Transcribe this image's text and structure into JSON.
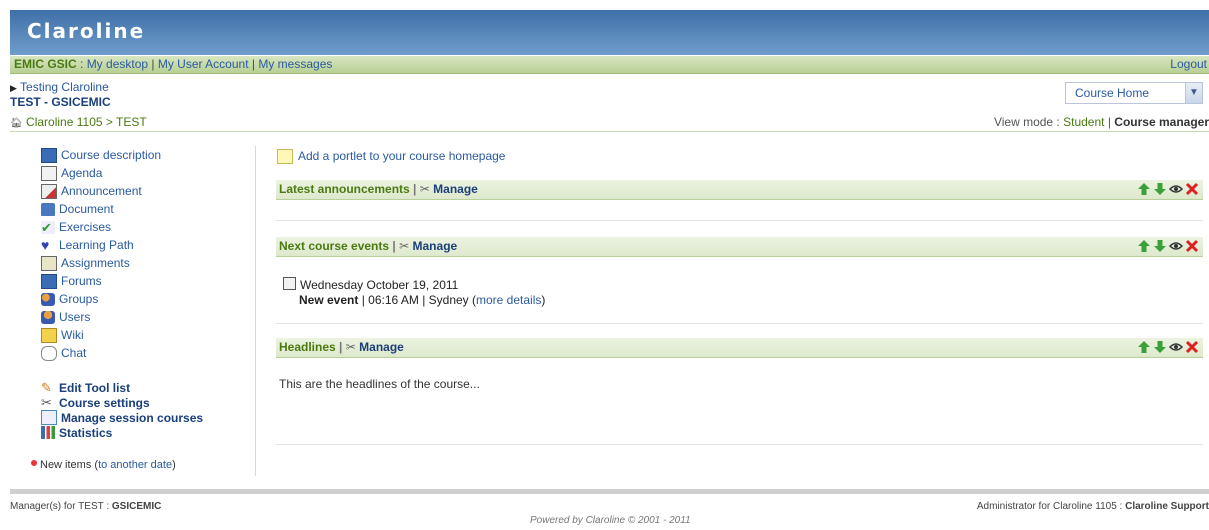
{
  "banner": {
    "title": "Claroline"
  },
  "userbar": {
    "user": "EMIC GSIC",
    "links": [
      "My desktop",
      "My User Account",
      "My messages"
    ],
    "logout": "Logout"
  },
  "course": {
    "category": "Testing Claroline",
    "name": "TEST - GSICEMIC",
    "tool_select": "Course Home"
  },
  "breadcrumb": {
    "platform": "Claroline 1105",
    "sep": ">",
    "course": "TEST"
  },
  "viewmode": {
    "label": "View mode :",
    "student": "Student",
    "divider": "|",
    "current": "Course manager"
  },
  "tools": [
    {
      "label": "Course description",
      "icon": "course-description-icon",
      "color": "#3a6db5"
    },
    {
      "label": "Agenda",
      "icon": "agenda-icon",
      "color": "#6d6d6d"
    },
    {
      "label": "Announcement",
      "icon": "announcement-icon",
      "color": "#b5463a"
    },
    {
      "label": "Document",
      "icon": "folder-icon",
      "color": "#3a6db5"
    },
    {
      "label": "Exercises",
      "icon": "checkmark-icon",
      "color": "#3a9a3a"
    },
    {
      "label": "Learning Path",
      "icon": "heart-icon",
      "color": "#3a4ab5"
    },
    {
      "label": "Assignments",
      "icon": "assignment-icon",
      "color": "#7a7a3a"
    },
    {
      "label": "Forums",
      "icon": "forum-icon",
      "color": "#3a6db5"
    },
    {
      "label": "Groups",
      "icon": "groups-icon",
      "color": "#c07a2a"
    },
    {
      "label": "Users",
      "icon": "user-icon",
      "color": "#c07a2a"
    },
    {
      "label": "Wiki",
      "icon": "wiki-icon",
      "color": "#d0a02a"
    },
    {
      "label": "Chat",
      "icon": "chat-bubble-icon",
      "color": "#9a9a9a"
    }
  ],
  "admin_tools": [
    {
      "label": "Edit Tool list",
      "icon": "pencil-icon"
    },
    {
      "label": "Course settings",
      "icon": "tools-icon"
    },
    {
      "label": "Manage session courses",
      "icon": "session-icon"
    },
    {
      "label": "Statistics",
      "icon": "statistics-icon"
    }
  ],
  "new_items": {
    "text": "New items (",
    "link": "to another date",
    "close": ")"
  },
  "main": {
    "add_portlet": "Add a portlet to your course homepage",
    "portlets": [
      {
        "title": "Latest announcements",
        "manage": "Manage"
      },
      {
        "title": "Next course events",
        "manage": "Manage"
      },
      {
        "title": "Headlines",
        "manage": "Manage"
      }
    ],
    "event": {
      "date": "Wednesday October 19, 2011",
      "name": "New event",
      "time": "| 06:16 AM | Sydney (",
      "details": "more details",
      "close": ")"
    },
    "headlines_text": "This are the headlines of the course..."
  },
  "footer": {
    "left_label": "Manager(s) for TEST :",
    "left_value": "GSICEMIC",
    "right_label": "Administrator for Claroline 1105 :",
    "right_value": "Claroline Support",
    "center": "Powered by Claroline © 2001 - 2011"
  },
  "colors": {
    "banner": "#4f80b8",
    "green_text": "#4a7a12",
    "link": "#2a5aa0",
    "delete": "#e02020",
    "arrow": "#3aa03a"
  }
}
